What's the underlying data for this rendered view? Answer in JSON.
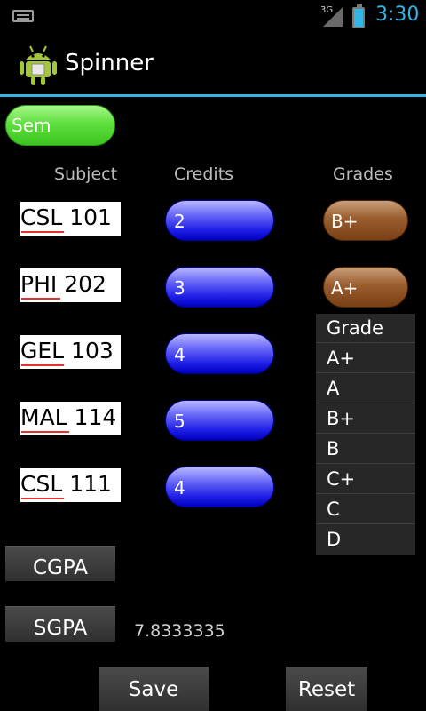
{
  "status_bar": {
    "network": "3G",
    "time": "3:30"
  },
  "action_bar": {
    "title": "Spinner"
  },
  "sem_spinner": {
    "label": "Sem"
  },
  "columns": {
    "subject": "Subject",
    "credits": "Credits",
    "grades": "Grades"
  },
  "rows": [
    {
      "subject": "CSL 101",
      "credits": "2",
      "grade": "B+"
    },
    {
      "subject": "PHI 202",
      "credits": "3",
      "grade": "A+"
    },
    {
      "subject": "GEL 103",
      "credits": "4"
    },
    {
      "subject": "MAL 114",
      "credits": "5"
    },
    {
      "subject": "CSL 111",
      "credits": "4"
    }
  ],
  "grade_dropdown": {
    "items": [
      "Grade",
      "A+",
      "A",
      "B+",
      "B",
      "C+",
      "C",
      "D"
    ]
  },
  "buttons": {
    "cgpa": "CGPA",
    "sgpa": "SGPA",
    "save": "Save",
    "reset": "Reset"
  },
  "sgpa_value": "7.8333335",
  "colors": {
    "accent": "#33b5e5",
    "sem": "#5ee03e",
    "credits": "#1e1ee6",
    "grades": "#9a5d2e"
  }
}
